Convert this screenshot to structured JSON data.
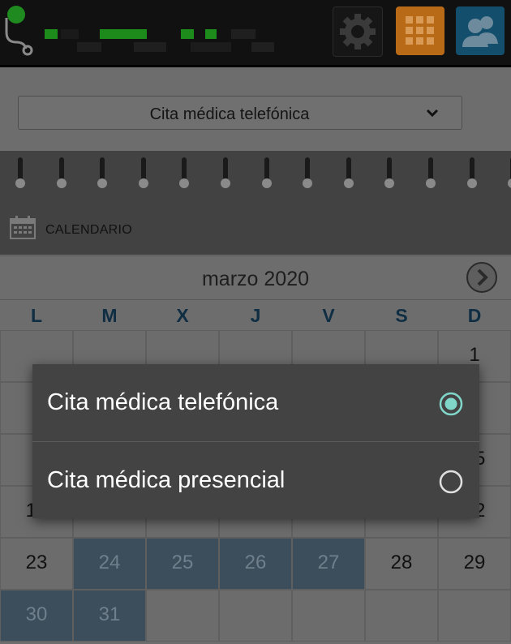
{
  "header": {
    "icons": [
      "stethoscope-icon",
      "settings-gear-icon",
      "apps-grid-icon",
      "users-icon"
    ],
    "colors": {
      "bar": "#111111",
      "grid_button": "#b86a16",
      "users_button": "#134e6d",
      "brand_green": "#1f8a1f"
    }
  },
  "appointment_select": {
    "value": "Cita médica telefónica"
  },
  "calendar": {
    "label": "CALENDARIO",
    "month": "marzo 2020",
    "weekdays": [
      "L",
      "M",
      "X",
      "J",
      "V",
      "S",
      "D"
    ],
    "highlight_color": "#3c4e5c",
    "weeks": [
      [
        "",
        "",
        "",
        "",
        "",
        "",
        "1"
      ],
      [
        "",
        "",
        "",
        "",
        "",
        "",
        ""
      ],
      [
        "",
        "",
        "",
        "",
        "",
        "",
        "15"
      ],
      [
        "16",
        "",
        "",
        "",
        "",
        "",
        "22"
      ],
      [
        "23",
        "24",
        "25",
        "26",
        "27",
        "28",
        "29"
      ],
      [
        "30",
        "31",
        "",
        "",
        "",
        "",
        ""
      ]
    ],
    "available_days": [
      "24",
      "25",
      "26",
      "27",
      "30",
      "31"
    ]
  },
  "dialog": {
    "options": [
      {
        "label": "Cita médica telefónica",
        "selected": true
      },
      {
        "label": "Cita médica presencial",
        "selected": false
      }
    ],
    "radio_color": "#7fd6c9"
  }
}
